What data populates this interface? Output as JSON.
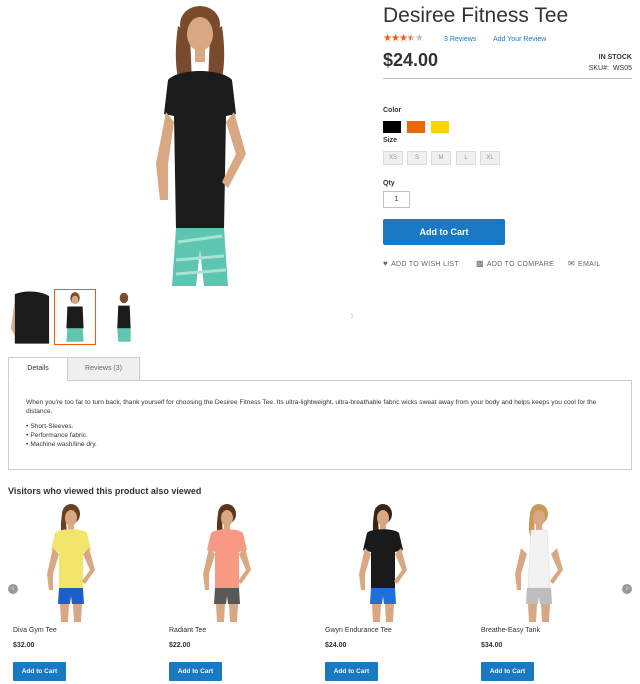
{
  "product": {
    "title": "Desiree Fitness Tee",
    "rating": {
      "stars_filled": 3.5,
      "stars_total": 5
    },
    "reviews_link": "3 Reviews",
    "add_review_link": "Add Your Review",
    "price": "$24.00",
    "stock": "IN STOCK",
    "sku_label": "SKU#:",
    "sku_value": "WS05",
    "color_label": "Color",
    "colors": [
      "#000000",
      "#eb6703",
      "#ffd500"
    ],
    "size_label": "Size",
    "sizes": [
      "XS",
      "S",
      "M",
      "L",
      "XL"
    ],
    "qty_label": "Qty",
    "qty_value": "1",
    "add_to_cart": "Add to Cart",
    "actions": {
      "wishlist": "ADD TO WISH LIST",
      "compare": "ADD TO COMPARE",
      "email": "EMAIL"
    },
    "gallery_active_index": 1
  },
  "tabs": {
    "details": "Details",
    "reviews": "Reviews (3)"
  },
  "details": {
    "description": "When you're too far to turn back, thank yourself for choosing the Desiree Fitness Tee. Its ultra-lightweight, ultra-breathable fabric wicks sweat away from your body and helps keeps you cool for the distance.",
    "features": [
      "Short-Sleeves.",
      "Performance fabric.",
      "Machine wash/line dry."
    ]
  },
  "also_viewed": {
    "title": "Visitors who viewed this product also viewed",
    "button_label": "Add to Cart",
    "items": [
      {
        "name": "Diva Gym Tee",
        "price": "$32.00",
        "top": "#f1e56b",
        "bottom": "#1c5fc8",
        "hair": "#6b3f22"
      },
      {
        "name": "Radiant Tee",
        "price": "$22.00",
        "top": "#f89a83",
        "bottom": "#585858",
        "hair": "#5b3520"
      },
      {
        "name": "Gwyn Endurance Tee",
        "price": "$24.00",
        "top": "#1a1a1a",
        "bottom": "#1e6fd8",
        "hair": "#3a2418"
      },
      {
        "name": "Breathe-Easy Tank",
        "price": "$34.00",
        "top": "#f2f2f2",
        "bottom": "#bdbdbd",
        "hair": "#c89a5a"
      }
    ]
  }
}
